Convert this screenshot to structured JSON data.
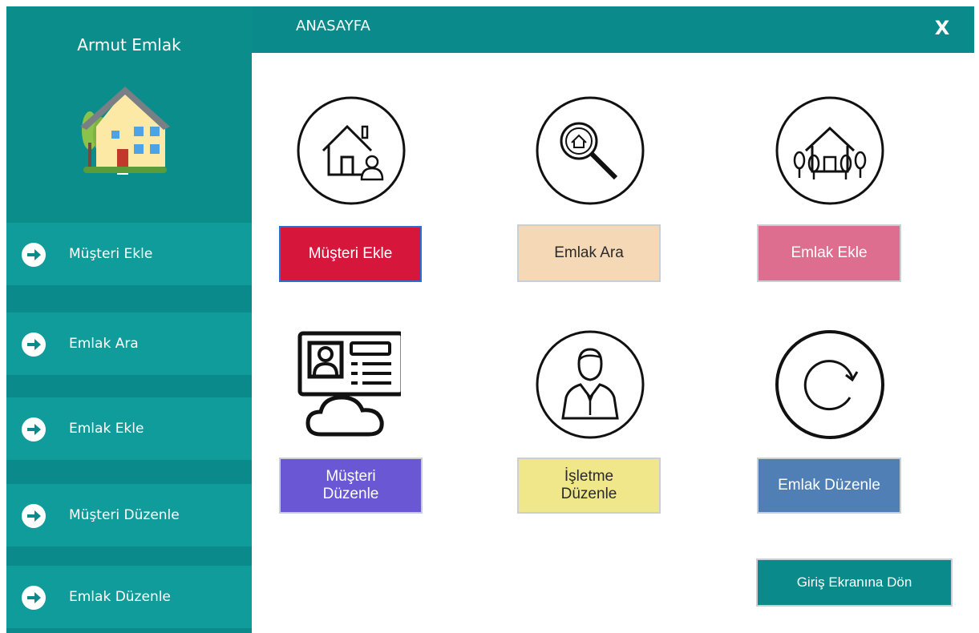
{
  "app": {
    "brand_title": "Armut Emlak",
    "header_title": "ANASAYFA",
    "close_label": "X"
  },
  "sidebar": {
    "items": [
      {
        "label": "Müşteri Ekle",
        "icon": "arrow-right-circle-icon"
      },
      {
        "label": "Emlak Ara",
        "icon": "arrow-right-circle-icon"
      },
      {
        "label": "Emlak Ekle",
        "icon": "arrow-right-circle-icon"
      },
      {
        "label": "Müşteri Düzenle",
        "icon": "arrow-right-circle-icon"
      },
      {
        "label": "Emlak Düzenle",
        "icon": "arrow-right-circle-icon"
      }
    ]
  },
  "tiles": [
    {
      "label": "Müşteri Ekle",
      "icon": "house-person-icon",
      "color": "#d6173b"
    },
    {
      "label": "Emlak Ara",
      "icon": "house-search-icon",
      "color": "#f5d9b6"
    },
    {
      "label": "Emlak Ekle",
      "icon": "house-trees-icon",
      "color": "#dd6e8f"
    },
    {
      "label": "Müşteri Düzenle",
      "icon": "profile-card-cloud-icon",
      "color": "#6a57d4"
    },
    {
      "label": "İşletme Düzenle",
      "icon": "businessman-icon",
      "color": "#f0e78a"
    },
    {
      "label": "Emlak Düzenle",
      "icon": "refresh-circle-icon",
      "color": "#4f7fb4"
    }
  ],
  "footer": {
    "back_label": "Giriş Ekranına Dön"
  },
  "colors": {
    "teal": "#0a8a8a",
    "teal_light": "#0f9c9a"
  }
}
